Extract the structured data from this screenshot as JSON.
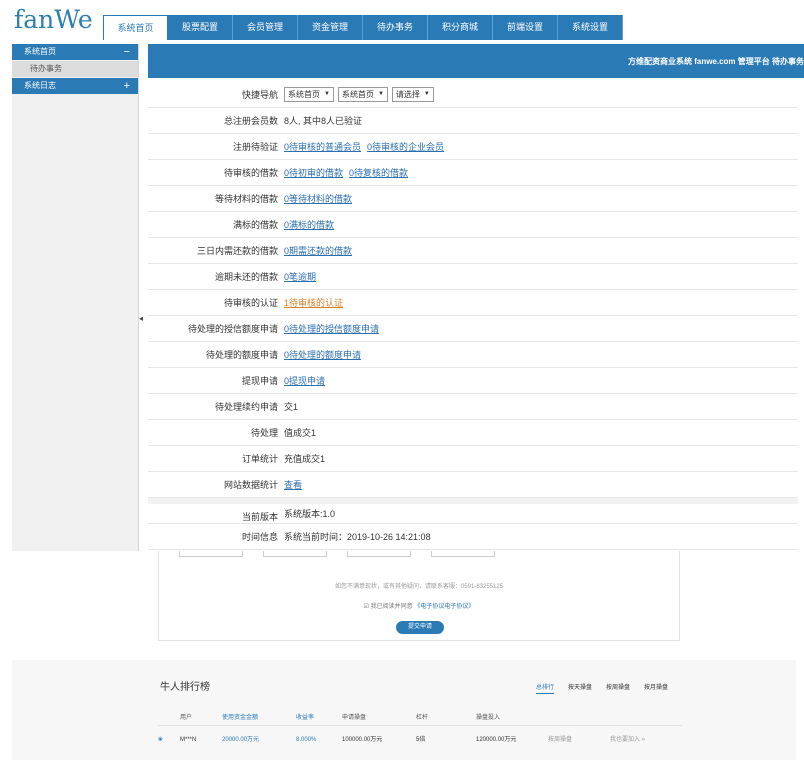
{
  "header": {
    "logo": "fanWe",
    "nav": [
      "系统首页",
      "股票配置",
      "会员管理",
      "资金管理",
      "待办事务",
      "积分商城",
      "前端设置",
      "系统设置"
    ],
    "active_nav": 0,
    "right_info": "方维配资商业系统 fanwe.com 管理平台 待办事务"
  },
  "sidebar": {
    "groups": [
      {
        "label": "系统首页",
        "sign": "−",
        "items": [
          "待办事务"
        ]
      },
      {
        "label": "系统日志",
        "sign": "+",
        "items": []
      }
    ]
  },
  "quick_nav": {
    "label": "快捷导航",
    "selects": [
      "系统首页",
      "系统首页",
      "请选择"
    ]
  },
  "rows": [
    {
      "label": "总注册会员数",
      "text": "8人, 其中8人已验证"
    },
    {
      "label": "注册待验证",
      "links": [
        "0待审核的普通会员",
        "0待审核的企业会员"
      ]
    },
    {
      "label": "待审核的借款",
      "links": [
        "0待初审的借款",
        "0待复核的借款"
      ]
    },
    {
      "label": "等待材料的借款",
      "links": [
        "0等待材料的借款"
      ]
    },
    {
      "label": "满标的借款",
      "links": [
        "0满标的借款"
      ]
    },
    {
      "label": "三日内需还款的借款",
      "links": [
        "0期需还款的借款"
      ]
    },
    {
      "label": "逾期未还的借款",
      "links": [
        "0笔逾期"
      ]
    },
    {
      "label": "待审核的认证",
      "links": [
        "1待审核的认证"
      ],
      "orange": true
    },
    {
      "label": "待处理的授信额度申请",
      "links": [
        "0待处理的授信额度申请"
      ]
    },
    {
      "label": "待处理的额度申请",
      "links": [
        "0待处理的额度申请"
      ]
    },
    {
      "label": "提现申请",
      "links": [
        "0提现申请"
      ]
    },
    {
      "label": "待处理续约申请",
      "text": "交1"
    },
    {
      "label": "待处理",
      "text": "值成交1"
    },
    {
      "label": "订单统计",
      "text": "充值成交1"
    },
    {
      "label": "网站数据统计",
      "links": [
        "查看"
      ]
    }
  ],
  "version_rows": [
    {
      "label": "当前版本",
      "text": "系统版本:1.0"
    },
    {
      "label": "时间信息",
      "text": "系统当前时间：2019-10-26 14:21:08"
    }
  ],
  "card": {
    "hint": "如您不满意现状，或有其他疑问，请联系客服：0591-83255125",
    "agree_text": "我已阅读并同意",
    "agree_link": "《电子协议电子协议》",
    "button": "提交申请"
  },
  "ranking": {
    "title": "牛人排行榜",
    "tabs": [
      "总排行",
      "按天操盘",
      "按周操盘",
      "按月操盘"
    ],
    "active_tab": 0,
    "headers": [
      "",
      "用户",
      "使用资金金额",
      "收益率",
      "申请操盘",
      "杠杆",
      "操盘投入",
      "",
      ""
    ],
    "rows": [
      {
        "icon": "❀",
        "user": "M***N",
        "fund": "20000.00万元",
        "rate": "8.000%",
        "apply": "100000.00万元",
        "lever": "5倍",
        "invest": "120000.00万元",
        "action": "按周操盘",
        "join": "我也要加入 »"
      }
    ]
  },
  "colors": {
    "brand": "#2a7ab6",
    "link": "#2a6fb0",
    "orange": "#d9822b"
  }
}
